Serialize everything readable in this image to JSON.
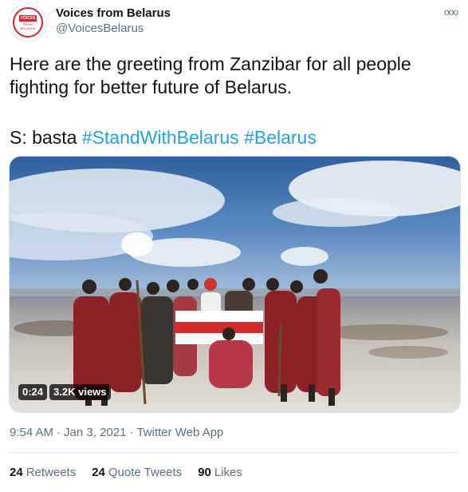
{
  "account": {
    "name": "Voices from Belarus",
    "handle": "@VoicesBelarus",
    "avatar": {
      "top": "VOICES",
      "middle": "FROM",
      "bottom": "BELARUS",
      "color": "#e3202a"
    }
  },
  "more_icon": "ooo",
  "tweet": {
    "text": "Here are the greeting from Zanzibar for all people fighting for better future of Belarus.",
    "prefix": "S: basta",
    "hashtags": [
      "#StandWithBelarus",
      "#Belarus"
    ]
  },
  "media": {
    "duration": "0:24",
    "views": "3.2K views",
    "flag_colors": [
      "#ffffff",
      "#d32b2b",
      "#ffffff"
    ]
  },
  "meta": {
    "time": "9:54 AM",
    "separator": "·",
    "date": "Jan 3, 2021",
    "source": "Twitter Web App"
  },
  "stats": {
    "retweets_count": "24",
    "retweets_label": "Retweets",
    "quotes_count": "24",
    "quotes_label": "Quote Tweets",
    "likes_count": "90",
    "likes_label": "Likes"
  },
  "colors": {
    "accent": "#1da1f2",
    "secondary_text": "#5b7083"
  }
}
